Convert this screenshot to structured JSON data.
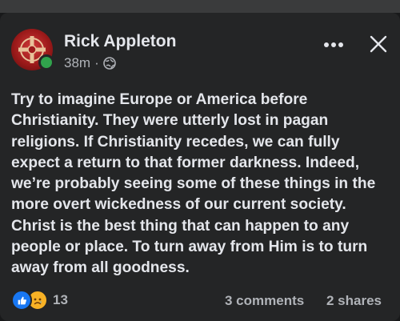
{
  "post": {
    "author": "Rick Appleton",
    "time": "38m",
    "separator": "·",
    "text": "Try to imagine Europe or America before Christianity. They were utterly lost in pagan religions. If Christianity recedes, we can fully expect a return to that former darkness. Indeed, we’re probably seeing some of these things in the more overt wickedness of our current society. Christ is the best thing that can happen to any people or place. To turn away from Him is to turn away from all goodness."
  },
  "footer": {
    "reaction_count": "13",
    "comments": "3 comments",
    "shares": "2 shares"
  },
  "icons": {
    "avatar": "celtic-cross-avatar",
    "privacy": "globe-icon",
    "more": "more-icon",
    "close": "close-icon",
    "reaction_like": "like-icon",
    "reaction_sad": "sad-icon"
  },
  "colors": {
    "background": "#18191a",
    "card": "#242526",
    "text": "#e4e6eb",
    "secondary": "#b0b3b8",
    "online": "#31a24c",
    "like": "#1877f2",
    "sad": "#f7b125"
  }
}
